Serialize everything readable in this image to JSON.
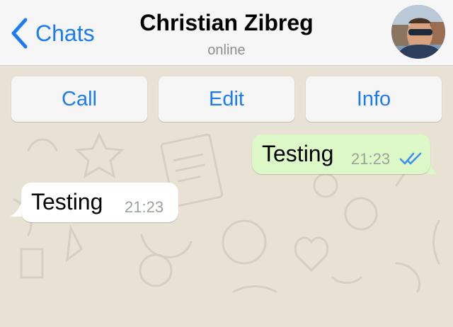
{
  "nav": {
    "back_label": "Chats",
    "contact_name": "Christian Zibreg",
    "status": "online"
  },
  "actions": {
    "call": "Call",
    "edit": "Edit",
    "info": "Info"
  },
  "messages": [
    {
      "direction": "outgoing",
      "text": "Testing",
      "time": "21:23",
      "read_receipt": "double-check-icon"
    },
    {
      "direction": "incoming",
      "text": "Testing",
      "time": "21:23"
    }
  ],
  "colors": {
    "accent": "#1a7cf5",
    "outgoing_bubble": "#dcf8c6",
    "incoming_bubble": "#ffffff",
    "chat_background": "#e8e2d5"
  }
}
